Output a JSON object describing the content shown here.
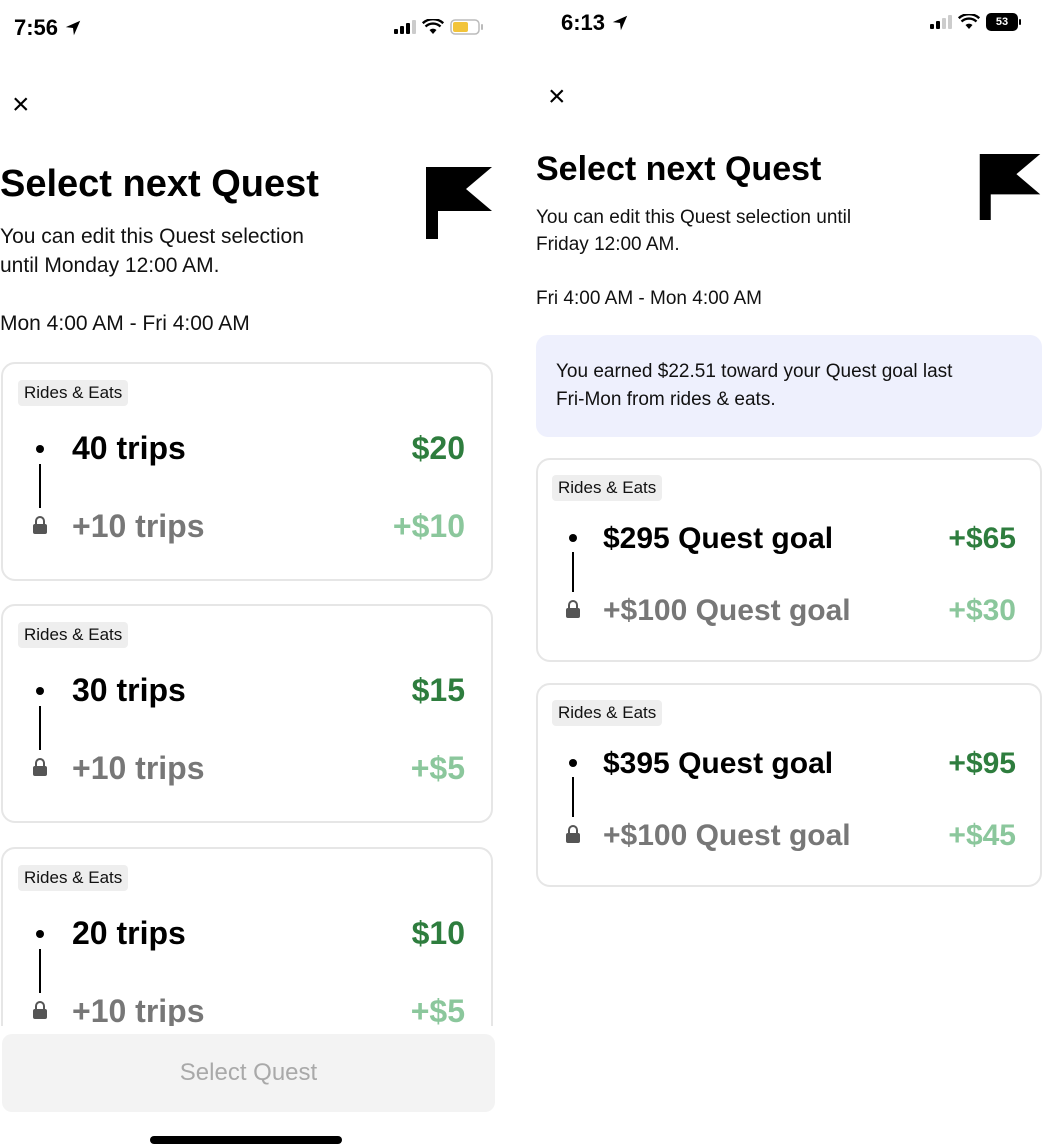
{
  "colors": {
    "goal_amount": "#2e7d3e",
    "bonus_amount": "#8bc79c",
    "info_box": "#eef0fd"
  },
  "left": {
    "time": "7:56",
    "close": "×",
    "title": "Select next Quest",
    "subtitle_line1": "You can edit this Quest selection",
    "subtitle_line2": "until Monday 12:00 AM.",
    "date_range": "Mon 4:00 AM - Fri 4:00 AM",
    "cards": [
      {
        "tag": "Rides & Eats",
        "goal": "40 trips",
        "amount": "$20",
        "next_goal": "+10 trips",
        "next_amount": "+$10"
      },
      {
        "tag": "Rides & Eats",
        "goal": "30 trips",
        "amount": "$15",
        "next_goal": "+10 trips",
        "next_amount": "+$5"
      },
      {
        "tag": "Rides & Eats",
        "goal": "20 trips",
        "amount": "$10",
        "next_goal": "+10 trips",
        "next_amount": "+$5"
      }
    ],
    "button_label": "Select Quest"
  },
  "right": {
    "time": "6:13",
    "battery": "53",
    "close": "×",
    "title": "Select next Quest",
    "subtitle_line1": "You can edit this Quest selection until",
    "subtitle_line2": "Friday 12:00 AM.",
    "date_range": "Fri 4:00 AM - Mon 4:00 AM",
    "earned_line1": "You earned $22.51 toward your Quest goal last",
    "earned_line2": "Fri-Mon from rides & eats.",
    "cards": [
      {
        "tag": "Rides & Eats",
        "goal": "$295 Quest goal",
        "amount": "+$65",
        "next_goal": "+$100 Quest goal",
        "next_amount": "+$30"
      },
      {
        "tag": "Rides & Eats",
        "goal": "$395 Quest goal",
        "amount": "+$95",
        "next_goal": "+$100 Quest goal",
        "next_amount": "+$45"
      }
    ]
  }
}
